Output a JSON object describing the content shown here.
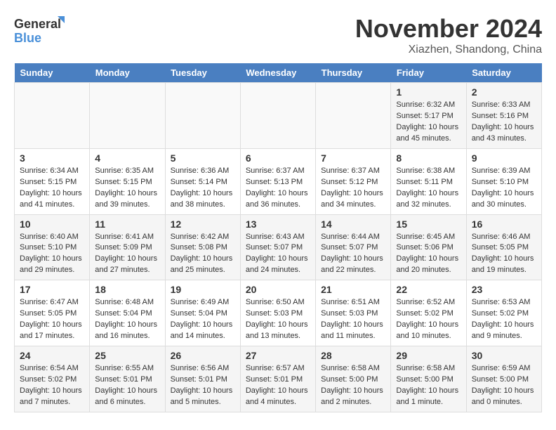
{
  "logo": {
    "line1": "General",
    "line2": "Blue"
  },
  "title": {
    "month": "November 2024",
    "location": "Xiazhen, Shandong, China"
  },
  "headers": [
    "Sunday",
    "Monday",
    "Tuesday",
    "Wednesday",
    "Thursday",
    "Friday",
    "Saturday"
  ],
  "weeks": [
    [
      {
        "day": "",
        "info": ""
      },
      {
        "day": "",
        "info": ""
      },
      {
        "day": "",
        "info": ""
      },
      {
        "day": "",
        "info": ""
      },
      {
        "day": "",
        "info": ""
      },
      {
        "day": "1",
        "info": "Sunrise: 6:32 AM\nSunset: 5:17 PM\nDaylight: 10 hours\nand 45 minutes."
      },
      {
        "day": "2",
        "info": "Sunrise: 6:33 AM\nSunset: 5:16 PM\nDaylight: 10 hours\nand 43 minutes."
      }
    ],
    [
      {
        "day": "3",
        "info": "Sunrise: 6:34 AM\nSunset: 5:15 PM\nDaylight: 10 hours\nand 41 minutes."
      },
      {
        "day": "4",
        "info": "Sunrise: 6:35 AM\nSunset: 5:15 PM\nDaylight: 10 hours\nand 39 minutes."
      },
      {
        "day": "5",
        "info": "Sunrise: 6:36 AM\nSunset: 5:14 PM\nDaylight: 10 hours\nand 38 minutes."
      },
      {
        "day": "6",
        "info": "Sunrise: 6:37 AM\nSunset: 5:13 PM\nDaylight: 10 hours\nand 36 minutes."
      },
      {
        "day": "7",
        "info": "Sunrise: 6:37 AM\nSunset: 5:12 PM\nDaylight: 10 hours\nand 34 minutes."
      },
      {
        "day": "8",
        "info": "Sunrise: 6:38 AM\nSunset: 5:11 PM\nDaylight: 10 hours\nand 32 minutes."
      },
      {
        "day": "9",
        "info": "Sunrise: 6:39 AM\nSunset: 5:10 PM\nDaylight: 10 hours\nand 30 minutes."
      }
    ],
    [
      {
        "day": "10",
        "info": "Sunrise: 6:40 AM\nSunset: 5:10 PM\nDaylight: 10 hours\nand 29 minutes."
      },
      {
        "day": "11",
        "info": "Sunrise: 6:41 AM\nSunset: 5:09 PM\nDaylight: 10 hours\nand 27 minutes."
      },
      {
        "day": "12",
        "info": "Sunrise: 6:42 AM\nSunset: 5:08 PM\nDaylight: 10 hours\nand 25 minutes."
      },
      {
        "day": "13",
        "info": "Sunrise: 6:43 AM\nSunset: 5:07 PM\nDaylight: 10 hours\nand 24 minutes."
      },
      {
        "day": "14",
        "info": "Sunrise: 6:44 AM\nSunset: 5:07 PM\nDaylight: 10 hours\nand 22 minutes."
      },
      {
        "day": "15",
        "info": "Sunrise: 6:45 AM\nSunset: 5:06 PM\nDaylight: 10 hours\nand 20 minutes."
      },
      {
        "day": "16",
        "info": "Sunrise: 6:46 AM\nSunset: 5:05 PM\nDaylight: 10 hours\nand 19 minutes."
      }
    ],
    [
      {
        "day": "17",
        "info": "Sunrise: 6:47 AM\nSunset: 5:05 PM\nDaylight: 10 hours\nand 17 minutes."
      },
      {
        "day": "18",
        "info": "Sunrise: 6:48 AM\nSunset: 5:04 PM\nDaylight: 10 hours\nand 16 minutes."
      },
      {
        "day": "19",
        "info": "Sunrise: 6:49 AM\nSunset: 5:04 PM\nDaylight: 10 hours\nand 14 minutes."
      },
      {
        "day": "20",
        "info": "Sunrise: 6:50 AM\nSunset: 5:03 PM\nDaylight: 10 hours\nand 13 minutes."
      },
      {
        "day": "21",
        "info": "Sunrise: 6:51 AM\nSunset: 5:03 PM\nDaylight: 10 hours\nand 11 minutes."
      },
      {
        "day": "22",
        "info": "Sunrise: 6:52 AM\nSunset: 5:02 PM\nDaylight: 10 hours\nand 10 minutes."
      },
      {
        "day": "23",
        "info": "Sunrise: 6:53 AM\nSunset: 5:02 PM\nDaylight: 10 hours\nand 9 minutes."
      }
    ],
    [
      {
        "day": "24",
        "info": "Sunrise: 6:54 AM\nSunset: 5:02 PM\nDaylight: 10 hours\nand 7 minutes."
      },
      {
        "day": "25",
        "info": "Sunrise: 6:55 AM\nSunset: 5:01 PM\nDaylight: 10 hours\nand 6 minutes."
      },
      {
        "day": "26",
        "info": "Sunrise: 6:56 AM\nSunset: 5:01 PM\nDaylight: 10 hours\nand 5 minutes."
      },
      {
        "day": "27",
        "info": "Sunrise: 6:57 AM\nSunset: 5:01 PM\nDaylight: 10 hours\nand 4 minutes."
      },
      {
        "day": "28",
        "info": "Sunrise: 6:58 AM\nSunset: 5:00 PM\nDaylight: 10 hours\nand 2 minutes."
      },
      {
        "day": "29",
        "info": "Sunrise: 6:58 AM\nSunset: 5:00 PM\nDaylight: 10 hours\nand 1 minute."
      },
      {
        "day": "30",
        "info": "Sunrise: 6:59 AM\nSunset: 5:00 PM\nDaylight: 10 hours\nand 0 minutes."
      }
    ]
  ]
}
